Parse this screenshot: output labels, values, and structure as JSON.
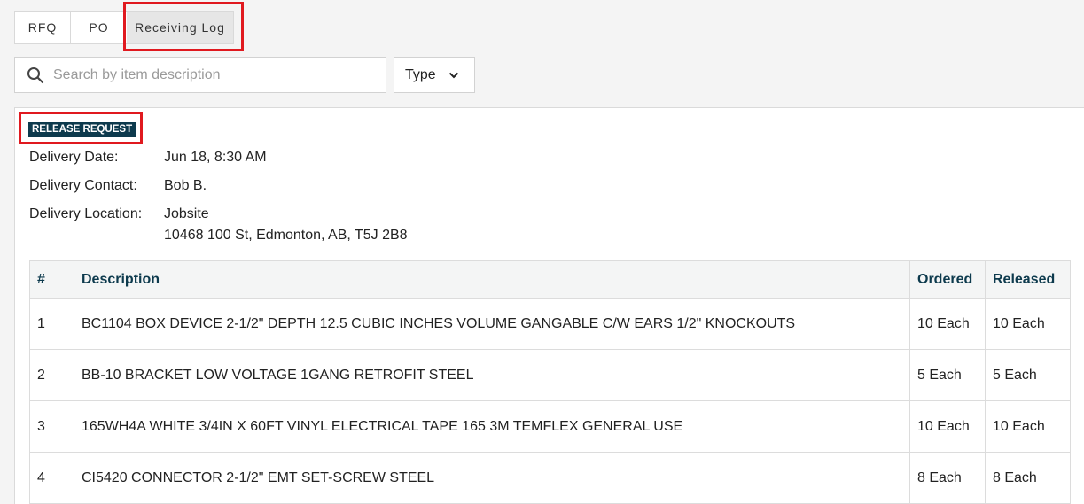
{
  "tabs": [
    {
      "label": "RFQ"
    },
    {
      "label": "PO"
    },
    {
      "label": "Receiving Log"
    }
  ],
  "search": {
    "placeholder": "Search by item description",
    "value": ""
  },
  "type_filter": {
    "label": "Type"
  },
  "release": {
    "badge": "RELEASE REQUEST",
    "delivery_date_label": "Delivery Date:",
    "delivery_date": "Jun 18, 8:30 AM",
    "delivery_contact_label": "Delivery Contact:",
    "delivery_contact": "Bob B.",
    "delivery_location_label": "Delivery Location:",
    "delivery_location_line1": "Jobsite",
    "delivery_location_line2": "10468 100 St, Edmonton, AB, T5J 2B8"
  },
  "table": {
    "headers": {
      "num": "#",
      "description": "Description",
      "ordered": "Ordered",
      "released": "Released"
    },
    "rows": [
      {
        "num": "1",
        "description": "BC1104 BOX DEVICE 2-1/2\" DEPTH 12.5 CUBIC INCHES VOLUME GANGABLE C/W EARS 1/2\" KNOCKOUTS",
        "ordered": "10 Each",
        "released": "10 Each"
      },
      {
        "num": "2",
        "description": "BB-10 BRACKET LOW VOLTAGE 1GANG RETROFIT STEEL",
        "ordered": "5 Each",
        "released": "5 Each"
      },
      {
        "num": "3",
        "description": "165WH4A WHITE 3/4IN X 60FT VINYL ELECTRICAL TAPE 165 3M TEMFLEX GENERAL USE",
        "ordered": "10 Each",
        "released": "10 Each"
      },
      {
        "num": "4",
        "description": "CI5420 CONNECTOR 2-1/2\" EMT SET-SCREW STEEL",
        "ordered": "8 Each",
        "released": "8 Each"
      }
    ]
  },
  "colors": {
    "highlight": "#e0191f",
    "badge_bg": "#0d3a4d",
    "header_text": "#0d3a4d"
  },
  "icons": {
    "search": "search-icon",
    "type_dropdown": "chevron-down-icon"
  }
}
